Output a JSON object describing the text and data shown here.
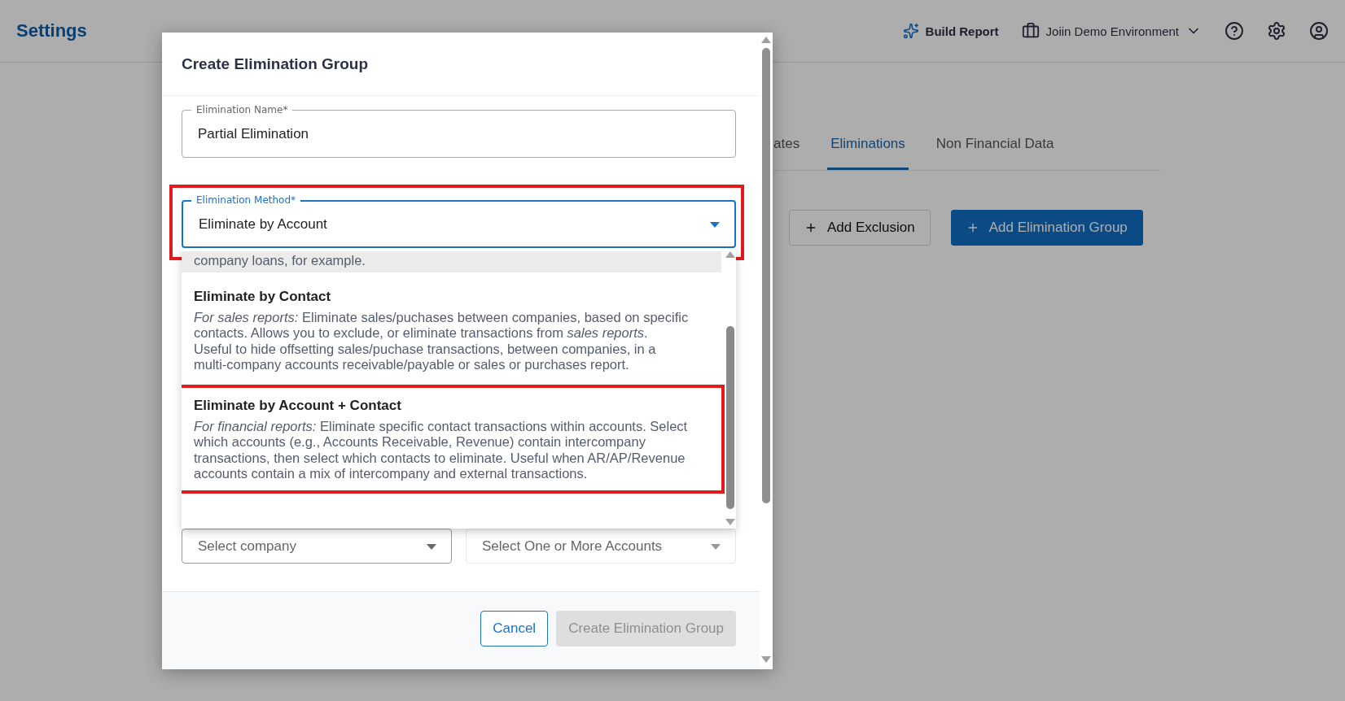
{
  "header": {
    "title": "Settings",
    "build_report": "Build Report",
    "environment": "Joiin Demo Environment"
  },
  "tabs": [
    {
      "label": "ates",
      "selected": false
    },
    {
      "label": "Eliminations",
      "selected": true
    },
    {
      "label": "Non Financial Data",
      "selected": false
    }
  ],
  "actions": [
    {
      "label": "Add Exclusion",
      "kind": "secondary"
    },
    {
      "label": "Add Elimination Group",
      "kind": "primary"
    }
  ],
  "dialog": {
    "title": "Create Elimination Group",
    "name_field": {
      "label": "Elimination Name*",
      "value": "Partial Elimination"
    },
    "method_field": {
      "label": "Elimination Method*",
      "value": "Eliminate by Account",
      "focused": true,
      "highlighted": true
    },
    "method_options": [
      {
        "description": "company loans, for example.",
        "selected": true,
        "highlighted": false
      },
      {
        "title": "Eliminate by Contact",
        "description": "*For sales reports:* Eliminate sales/puchases between companies, based on specific contacts. Allows you to exclude, or eliminate transactions from *sales reports*. Useful to hide offsetting sales/puchase transactions, between companies, in a multi-company accounts receivable/payable or sales or purchases report.",
        "selected": false,
        "highlighted": false
      },
      {
        "title": "Eliminate by Account + Contact",
        "description": "*For financial reports:* Eliminate specific contact transactions within accounts. Select which accounts (e.g., Accounts Receivable, Revenue) contain intercompany transactions, then select which contacts to eliminate. Useful when AR/AP/Revenue accounts contain a mix of intercompany and external transactions.",
        "selected": false,
        "highlighted": true
      }
    ],
    "company_select": {
      "placeholder": "Select company",
      "disabled": false
    },
    "accounts_select": {
      "placeholder": "Select One or More Accounts",
      "disabled": true
    },
    "buttons": [
      {
        "label": "Cancel",
        "kind": "outline",
        "disabled": false
      },
      {
        "label": "Create Elimination Group",
        "kind": "primary",
        "disabled": true
      }
    ]
  }
}
